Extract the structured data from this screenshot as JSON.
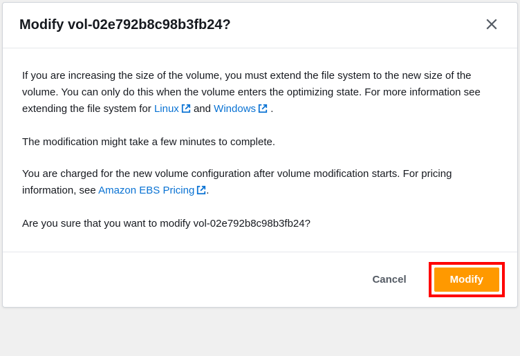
{
  "modal": {
    "title": "Modify vol-02e792b8c98b3fb24?",
    "body": {
      "p1_part1": "If you are increasing the size of the volume, you must extend the file system to the new size of the volume. You can only do this when the volume enters the optimizing state. For more information see extending the file system for ",
      "link_linux": "Linux",
      "p1_part2": " and ",
      "link_windows": "Windows",
      "p1_part3": " .",
      "p2": "The modification might take a few minutes to complete.",
      "p3_part1": "You are charged for the new volume configuration after volume modification starts. For pricing information, see ",
      "link_pricing": "Amazon EBS Pricing",
      "p3_part2": ".",
      "p4": "Are you sure that you want to modify vol-02e792b8c98b3fb24?"
    },
    "footer": {
      "cancel_label": "Cancel",
      "modify_label": "Modify"
    }
  }
}
